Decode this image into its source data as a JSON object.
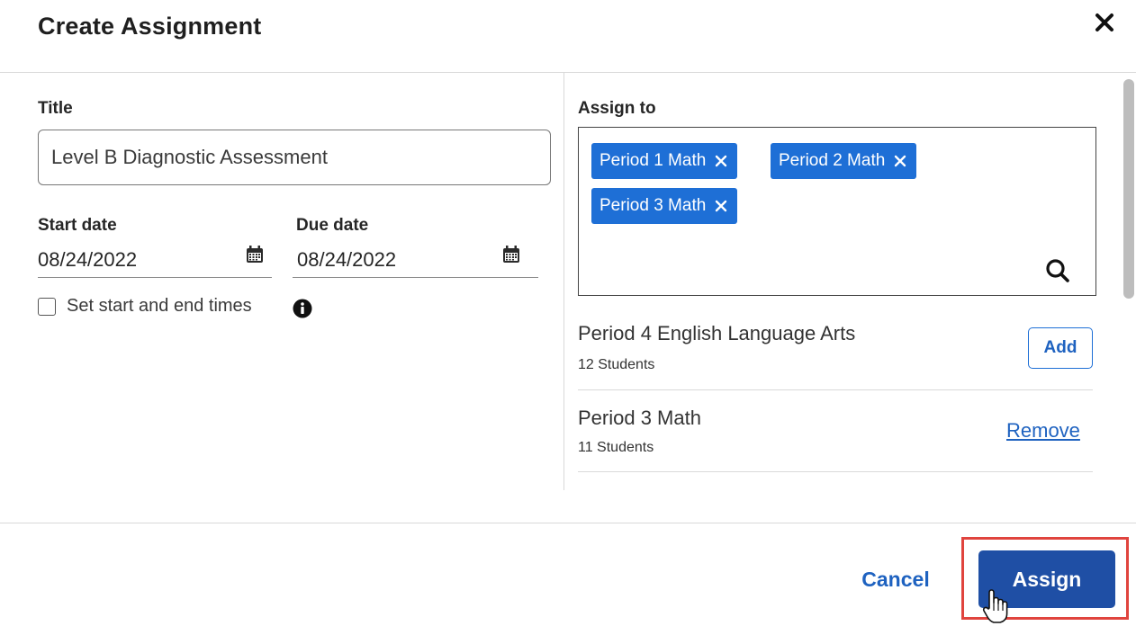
{
  "dialog": {
    "title": "Create Assignment"
  },
  "form": {
    "title_label": "Title",
    "title_value": "Level B Diagnostic Assessment",
    "start_date_label": "Start date",
    "start_date_value": "08/24/2022",
    "due_date_label": "Due date",
    "due_date_value": "08/24/2022",
    "times_checkbox_label": "Set start and end times",
    "times_checkbox_checked": false
  },
  "assign": {
    "label": "Assign to",
    "chips": [
      {
        "label": "Period 1 Math"
      },
      {
        "label": "Period 2 Math"
      },
      {
        "label": "Period 3 Math"
      }
    ],
    "classes": [
      {
        "name": "Period 4 English Language Arts",
        "students": "12 Students",
        "action": "Add"
      },
      {
        "name": "Period 3 Math",
        "students": "11 Students",
        "action": "Remove"
      }
    ]
  },
  "footer": {
    "cancel_label": "Cancel",
    "assign_label": "Assign"
  },
  "colors": {
    "chip_blue": "#1e6fd6",
    "primary_button": "#1f4fa5",
    "link_blue": "#1e62c0",
    "highlight_red": "#e0443e"
  },
  "icons": [
    "close-icon",
    "calendar-icon",
    "info-icon",
    "chip-remove-icon",
    "search-icon",
    "hand-pointer-cursor-icon"
  ]
}
